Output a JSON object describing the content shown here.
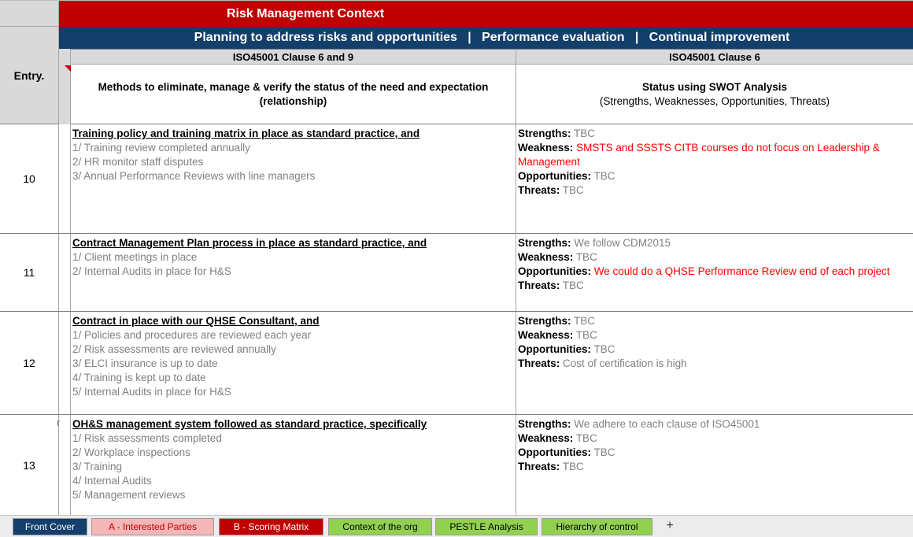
{
  "header": {
    "title": "Risk Management Context",
    "subtitle": "Planning to address risks and opportunities   |   Performance evaluation   |   Continual improvement",
    "entry_label": "Entry.",
    "clause_left": "ISO45001 Clause 6 and 9",
    "clause_right": "ISO45001 Clause 6",
    "desc_left": "Methods to eliminate, manage & verify the status of the need and expectation (relationship)",
    "desc_right_title": "Status using SWOT Analysis",
    "desc_right_sub": "(Strengths, Weaknesses, Opportunities, Threats)"
  },
  "rows": [
    {
      "entry": "10",
      "heading": "Training policy and training matrix in place as standard practice, and",
      "items": [
        "1/ Training review completed annually",
        "2/ HR monitor staff disputes",
        "3/ Annual Performance Reviews with line managers"
      ],
      "strengths": "TBC",
      "weakness": "SMSTS and SSSTS CITB courses do not focus on Leadership & Management",
      "opportunities": "TBC",
      "threats": "TBC"
    },
    {
      "entry": "11",
      "heading": "Contract Management Plan process in place as standard practice, and",
      "items": [
        "1/ Client meetings in place",
        "2/ Internal Audits in place for H&S"
      ],
      "strengths": "We follow CDM2015",
      "weakness": "TBC",
      "opportunities": "We could do a QHSE Performance Review end of each project",
      "threats": "TBC"
    },
    {
      "entry": "12",
      "heading": "Contract in place with our QHSE Consultant, and",
      "items": [
        "1/ Policies and procedures are reviewed each year",
        "2/ Risk assessments are reviewed annually",
        "3/ ELCI insurance is up to date",
        "4/ Training is kept up to date",
        "5/ Internal Audits in place for H&S"
      ],
      "strengths": "TBC",
      "weakness": "TBC",
      "opportunities": "TBC",
      "threats": "Cost of certification is high"
    },
    {
      "entry": "13",
      "stub": "r",
      "heading": "OH&S management system followed as standard practice, specifically",
      "items": [
        "1/ Risk assessments completed",
        "2/ Workplace inspections",
        "3/ Training",
        "4/ Internal Audits",
        "5/ Management reviews"
      ],
      "strengths": "We adhere to each clause of ISO45001",
      "weakness": "TBC",
      "opportunities": "TBC",
      "threats": "TBC"
    }
  ],
  "swot_labels": {
    "strengths": "Strengths:",
    "weakness": "Weakness:",
    "opportunities": "Opportunities:",
    "threats": "Threats:"
  },
  "tabs": [
    {
      "label": "Front Cover",
      "bg": "#133f6a",
      "fg": "#ffffff"
    },
    {
      "label": "A - Interested Parties",
      "bg": "#f4b6b6",
      "fg": "#c00000"
    },
    {
      "label": "B - Scoring Matrix",
      "bg": "#c00000",
      "fg": "#ffffff"
    },
    {
      "label": "Context of the org",
      "bg": "#92d050",
      "fg": "#000000"
    },
    {
      "label": "PESTLE Analysis",
      "bg": "#92d050",
      "fg": "#000000"
    },
    {
      "label": "Hierarchy of control",
      "bg": "#92d050",
      "fg": "#000000"
    }
  ],
  "add_tab": "+",
  "colors": {
    "title_red": "#c00000",
    "navy": "#133f6a",
    "header_gray": "#d9d9d9",
    "muted_text": "#808080",
    "alert_red": "#ff0000"
  }
}
